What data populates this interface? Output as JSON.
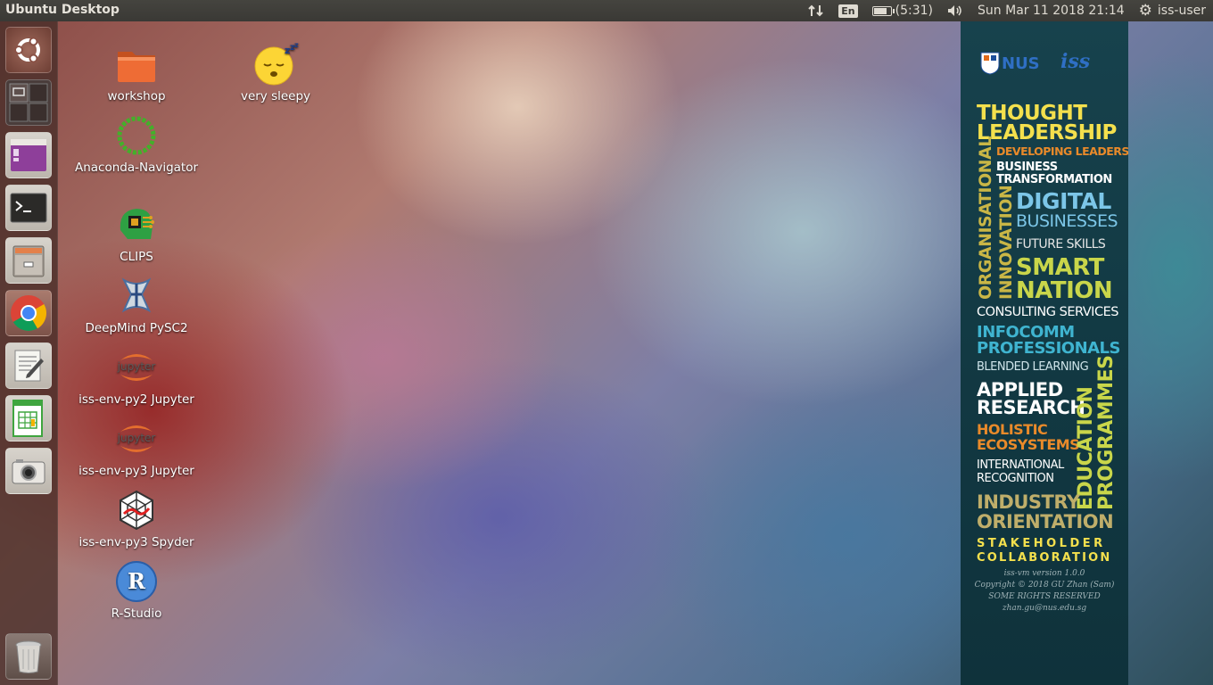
{
  "panel": {
    "title": "Ubuntu Desktop",
    "keyboard_layout": "En",
    "battery_time": "(5:31)",
    "battery_level": 0.8,
    "datetime": "Sun Mar 11 2018 21:14",
    "user": "iss-user"
  },
  "launcher": {
    "items": [
      {
        "name": "ubuntu-dash-icon"
      },
      {
        "name": "workspace-switcher-icon"
      },
      {
        "name": "software-center-icon"
      },
      {
        "name": "terminal-icon"
      },
      {
        "name": "files-icon"
      },
      {
        "name": "chrome-icon"
      },
      {
        "name": "text-editor-icon"
      },
      {
        "name": "spreadsheet-icon"
      },
      {
        "name": "camera-icon"
      },
      {
        "name": "trash-icon"
      }
    ]
  },
  "desktop": {
    "icons": [
      {
        "label": "workshop",
        "icon": "folder-icon"
      },
      {
        "label": "very sleepy",
        "icon": "sleepy-emoji-icon"
      },
      {
        "label": "Anaconda-Navigator",
        "icon": "anaconda-icon"
      },
      {
        "label": "CLIPS",
        "icon": "clips-icon"
      },
      {
        "label": "DeepMind PySC2",
        "icon": "starcraft-icon"
      },
      {
        "label": "iss-env-py2 Jupyter",
        "icon": "jupyter-icon"
      },
      {
        "label": "iss-env-py3 Jupyter",
        "icon": "jupyter-icon"
      },
      {
        "label": "iss-env-py3 Spyder",
        "icon": "spyder-icon"
      },
      {
        "label": "R-Studio",
        "icon": "rstudio-icon"
      }
    ]
  },
  "banner": {
    "logo_nus": "NUS",
    "logo_iss": "iss",
    "thought": "THOUGHT",
    "leadership": "LEADERSHIP",
    "developing_leaders": "DEVELOPING LEADERS",
    "business": "BUSINESS",
    "transformation": "TRANSFORMATION",
    "organisational": "ORGANISATIONAL",
    "innovation": "INNOVATION",
    "digital": "DIGITAL",
    "businesses": "BUSINESSES",
    "future_skills": "FUTURE SKILLS",
    "smart": "SMART",
    "nation": "NATION",
    "consulting": "CONSULTING SERVICES",
    "infocomm": "INFOCOMM",
    "professionals": "PROFESSIONALS",
    "blended": "BLENDED LEARNING",
    "applied": "APPLIED",
    "research": "RESEARCH",
    "holistic": "HOLISTIC",
    "ecosystems": "ECOSYSTEMS",
    "international": "INTERNATIONAL",
    "recognition": "RECOGNITION",
    "education": "EDUCATION",
    "programmes": "PROGRAMMES",
    "industry": "INDUSTRY",
    "orientation": "ORIENTATION",
    "stakeholder": "STAKEHOLDER",
    "collaboration": "COLLABORATION",
    "version": "iss-vm version 1.0.0",
    "copyright": "Copyright © 2018 GU Zhan (Sam)",
    "rights": "SOME RIGHTS RESERVED",
    "email": "zhan.gu@nus.edu.sg"
  },
  "colors": {
    "yellow": "#f4e04d",
    "orange": "#e98a2a",
    "blue": "#7cc6e8",
    "lime": "#c9d64a",
    "white": "#ffffff",
    "olive": "#bfae6a"
  }
}
